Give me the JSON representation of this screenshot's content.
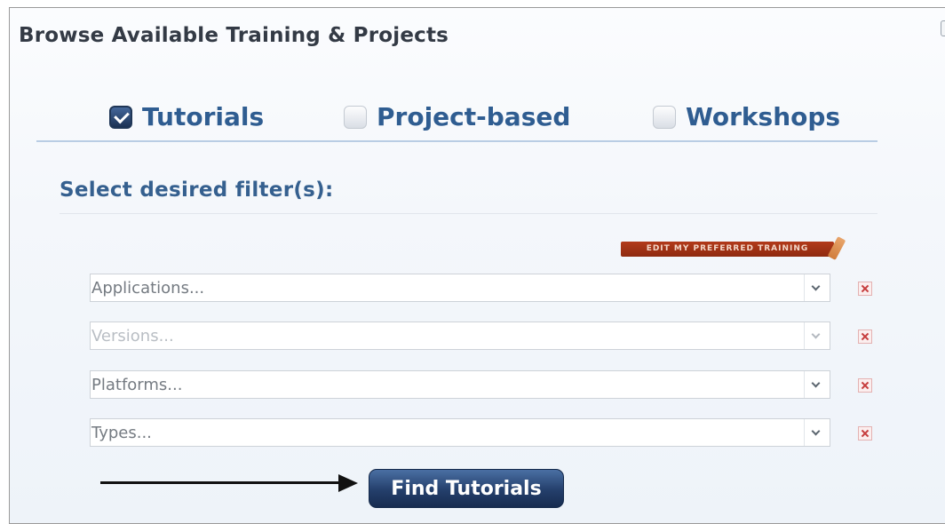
{
  "panel": {
    "title": "Browse Available Training & Projects"
  },
  "types": [
    {
      "label": "Tutorials",
      "checked": true
    },
    {
      "label": "Project-based",
      "checked": false
    },
    {
      "label": "Workshops",
      "checked": false
    }
  ],
  "filters": {
    "heading": "Select desired filter(s):",
    "edit_preferred_label": "EDIT MY PREFERRED TRAINING",
    "items": [
      {
        "placeholder": "Applications...",
        "disabled": false
      },
      {
        "placeholder": "Versions...",
        "disabled": true
      },
      {
        "placeholder": "Platforms...",
        "disabled": false
      },
      {
        "placeholder": "Types...",
        "disabled": false
      }
    ]
  },
  "action": {
    "find_label": "Find Tutorials"
  },
  "colors": {
    "title": "#333a45",
    "accent_blue": "#2f5d91",
    "button_navy": "#243f6b",
    "edit_badge": "#a3341a",
    "remove_red": "#c63c3c"
  }
}
